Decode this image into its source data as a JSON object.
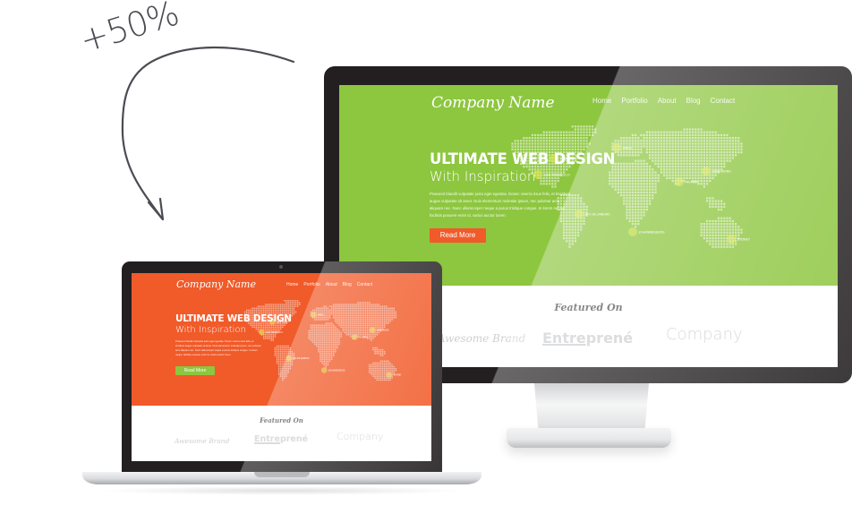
{
  "annotation": {
    "text": "+50%",
    "arrow_icon": "curved-arrow-icon"
  },
  "website": {
    "logo": "Company Name",
    "nav": [
      "Home",
      "Portfolio",
      "About",
      "Blog",
      "Contact"
    ],
    "headline": "ULTIMATE WEB DESIGN",
    "subheadline": "With Inspiration",
    "body": "Praesent blandit vulputate justo eget egestas. Donec viverra risus felis, et tincidunt augue vulputate sit amet. Duis elementum molestie ipsum, nec pulvinar arcu aliquam nec. Nunc ullamcorper neque a purus tristique congue. In lorem neque, facilisis posuere enim id, varius auctor lorem.",
    "cta_label": "Read More",
    "map_cities": [
      "SAN FRANCISCO",
      "NEW YORK",
      "PARIS",
      "RIO DE JANEIRO",
      "JOHANNESBURG",
      "MUMBAI",
      "HONGKONG",
      "SYDNEY"
    ],
    "featured_title": "Featured On",
    "brands": {
      "awesome": "Awesome Brand",
      "entre_underlined": "Entre",
      "entre_rest": "prené",
      "company": "Company"
    }
  },
  "devices": {
    "monitor": {
      "theme_color": "#8dc63f",
      "cta_color": "#f15a29"
    },
    "laptop": {
      "theme_color": "#f15a29",
      "cta_color": "#8dc63f"
    }
  },
  "colors": {
    "bezel": "#231f20",
    "annotation": "#4a4c52",
    "brand_gray": "#cfd0d2",
    "city_dot": "#e3ea4b"
  }
}
